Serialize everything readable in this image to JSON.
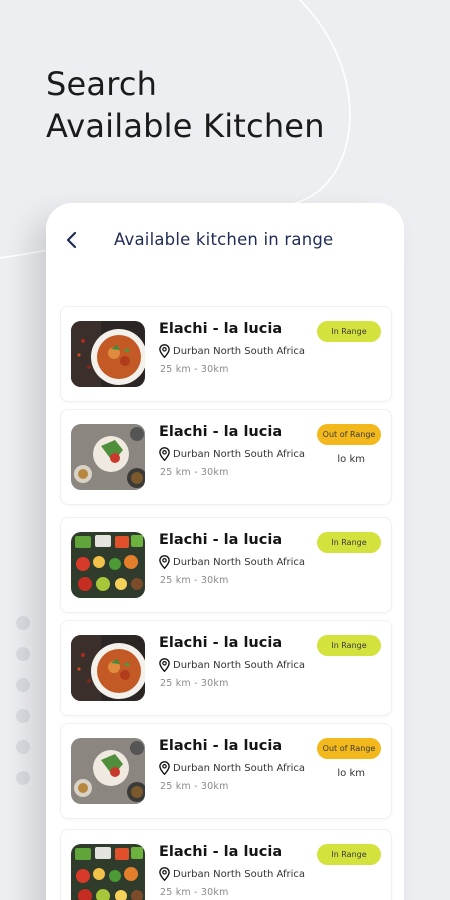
{
  "promo": {
    "line1": "Search",
    "line2": "Available Kitchen"
  },
  "header": {
    "title": "Available kitchen in range"
  },
  "colors": {
    "in_range": "#d3e23c",
    "out_of_range": "#f2b81c",
    "title": "#1e2b56"
  },
  "kitchens": [
    {
      "name": "Elachi - la lucia",
      "address": "Durban North South Africa",
      "distance": "25 km - 30km",
      "status": "In Range",
      "km": "",
      "image": "curry-bowl"
    },
    {
      "name": "Elachi - la lucia",
      "address": "Durban North South Africa",
      "distance": "25 km - 30km",
      "status": "Out of Range",
      "km": "lo km",
      "image": "plated-dishes"
    },
    {
      "name": "Elachi - la lucia",
      "address": "Durban North South Africa",
      "distance": "25 km - 30km",
      "status": "In Range",
      "km": "",
      "image": "vegetables"
    },
    {
      "name": "Elachi - la lucia",
      "address": "Durban North South Africa",
      "distance": "25 km - 30km",
      "status": "In Range",
      "km": "",
      "image": "curry-bowl"
    },
    {
      "name": "Elachi - la lucia",
      "address": "Durban North South Africa",
      "distance": "25 km - 30km",
      "status": "Out of Range",
      "km": "lo km",
      "image": "plated-dishes"
    },
    {
      "name": "Elachi - la lucia",
      "address": "Durban North South Africa",
      "distance": "25 km - 30km",
      "status": "In Range",
      "km": "",
      "image": "vegetables"
    }
  ]
}
